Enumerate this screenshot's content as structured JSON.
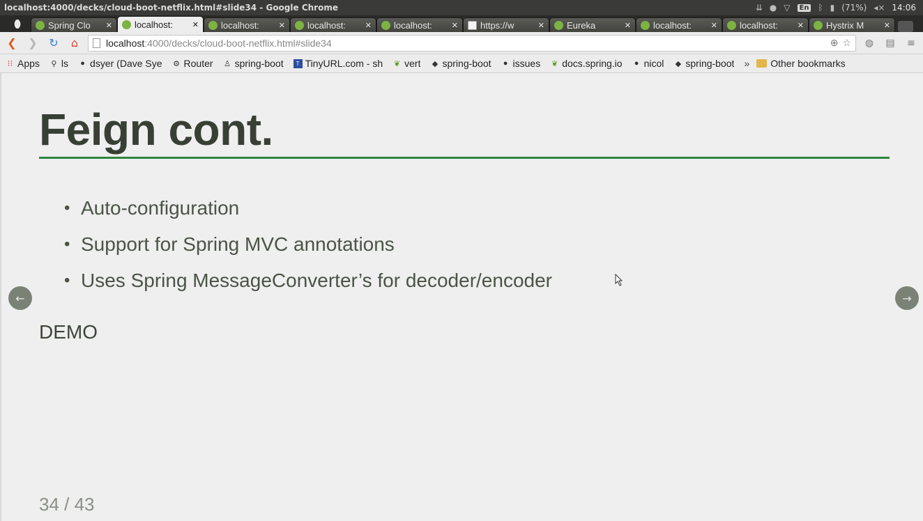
{
  "os": {
    "window_title": "localhost:4000/decks/cloud-boot-netflix.html#slide34 - Google Chrome",
    "language": "En",
    "battery": "(71%)",
    "clock": "14:06"
  },
  "tabs": [
    {
      "label": "Spring Clo",
      "favicon": "spring-leaf-icon",
      "active": false
    },
    {
      "label": "localhost:",
      "favicon": "spring-leaf-icon",
      "active": true
    },
    {
      "label": "localhost:",
      "favicon": "spring-leaf-icon",
      "active": false
    },
    {
      "label": "localhost:",
      "favicon": "spring-leaf-icon",
      "active": false
    },
    {
      "label": "localhost:",
      "favicon": "spring-leaf-icon",
      "active": false
    },
    {
      "label": "https://w",
      "favicon": "page-icon",
      "active": false
    },
    {
      "label": "Eureka",
      "favicon": "spring-leaf-icon",
      "active": false
    },
    {
      "label": "localhost:",
      "favicon": "spring-leaf-icon",
      "active": false
    },
    {
      "label": "localhost:",
      "favicon": "spring-leaf-icon",
      "active": false
    },
    {
      "label": "Hystrix M",
      "favicon": "spring-leaf-icon",
      "active": false
    }
  ],
  "toolbar": {
    "url_host": "localhost",
    "url_rest": ":4000/decks/cloud-boot-netflix.html#slide34"
  },
  "bookmarks": {
    "items": [
      {
        "label": "Apps",
        "icon": "apps-grid-icon"
      },
      {
        "label": "ls",
        "icon": "search-icon"
      },
      {
        "label": "dsyer (Dave Sye",
        "icon": "github-icon"
      },
      {
        "label": "Router",
        "icon": "router-icon"
      },
      {
        "label": "spring-boot",
        "icon": "spring-boot-icon"
      },
      {
        "label": "TinyURL.com - sh",
        "icon": "tinyurl-icon"
      },
      {
        "label": "vert",
        "icon": "spring-leaf-icon"
      },
      {
        "label": "spring-boot",
        "icon": "diamond-icon"
      },
      {
        "label": "issues",
        "icon": "github-icon"
      },
      {
        "label": "docs.spring.io",
        "icon": "spring-leaf-icon"
      },
      {
        "label": "nicol",
        "icon": "github-icon"
      },
      {
        "label": "spring-boot",
        "icon": "diamond-icon"
      }
    ],
    "more": "»",
    "other": "Other bookmarks"
  },
  "slide": {
    "title": "Feign cont.",
    "bullets": [
      "Auto-configuration",
      "Support for Spring MVC annotations",
      "Uses Spring MessageConverter’s for decoder/encoder"
    ],
    "demo": "DEMO",
    "prev": "←",
    "next": "→",
    "counter": "34 / 43",
    "accent_color": "#2e8640"
  }
}
